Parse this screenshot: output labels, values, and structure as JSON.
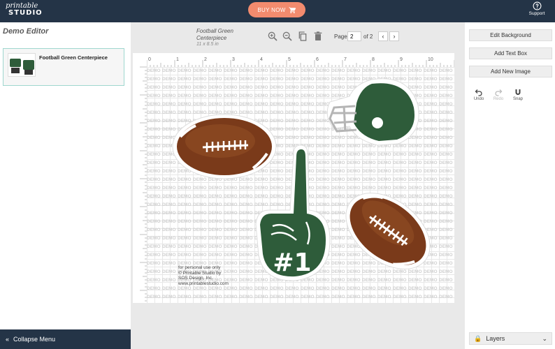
{
  "topbar": {
    "logo_line1": "printable",
    "logo_line2": "STUDIO",
    "buy_now": "BUY NOW",
    "support": "Support",
    "accent": "#f28b6e",
    "bg": "#243447"
  },
  "left_panel": {
    "title": "Demo Editor",
    "thumbnail_label": "Football Green Centerpiece",
    "collapse_label": "Collapse Menu"
  },
  "toolbar": {
    "doc_name": "Football Green Centerpiece",
    "doc_size": "11 x 8.5 in",
    "page_label": "Page",
    "page_value": "2",
    "page_of": "of 2",
    "icons": [
      "zoom-in-icon",
      "zoom-out-icon",
      "copy-icon",
      "trash-icon"
    ]
  },
  "canvas": {
    "ruler_numbers": [
      "0",
      "1",
      "2",
      "3",
      "4",
      "5",
      "6",
      "7",
      "8",
      "9",
      "10"
    ],
    "watermark_word": "DEMO",
    "copyright_lines": [
      "for personal use only",
      "© Printable Studio by",
      "SOS Design, Inc.",
      "www.printablestudio.com"
    ],
    "finger_text": "#1",
    "colors": {
      "green": "#2e5c3a",
      "football_brown": "#7a3a1a"
    }
  },
  "right_panel": {
    "edit_background": "Edit Background",
    "add_text_box": "Add Text Box",
    "add_new_image": "Add New Image",
    "undo": "Undo",
    "redo": "Redo",
    "snap": "Snap",
    "layers": "Layers"
  }
}
